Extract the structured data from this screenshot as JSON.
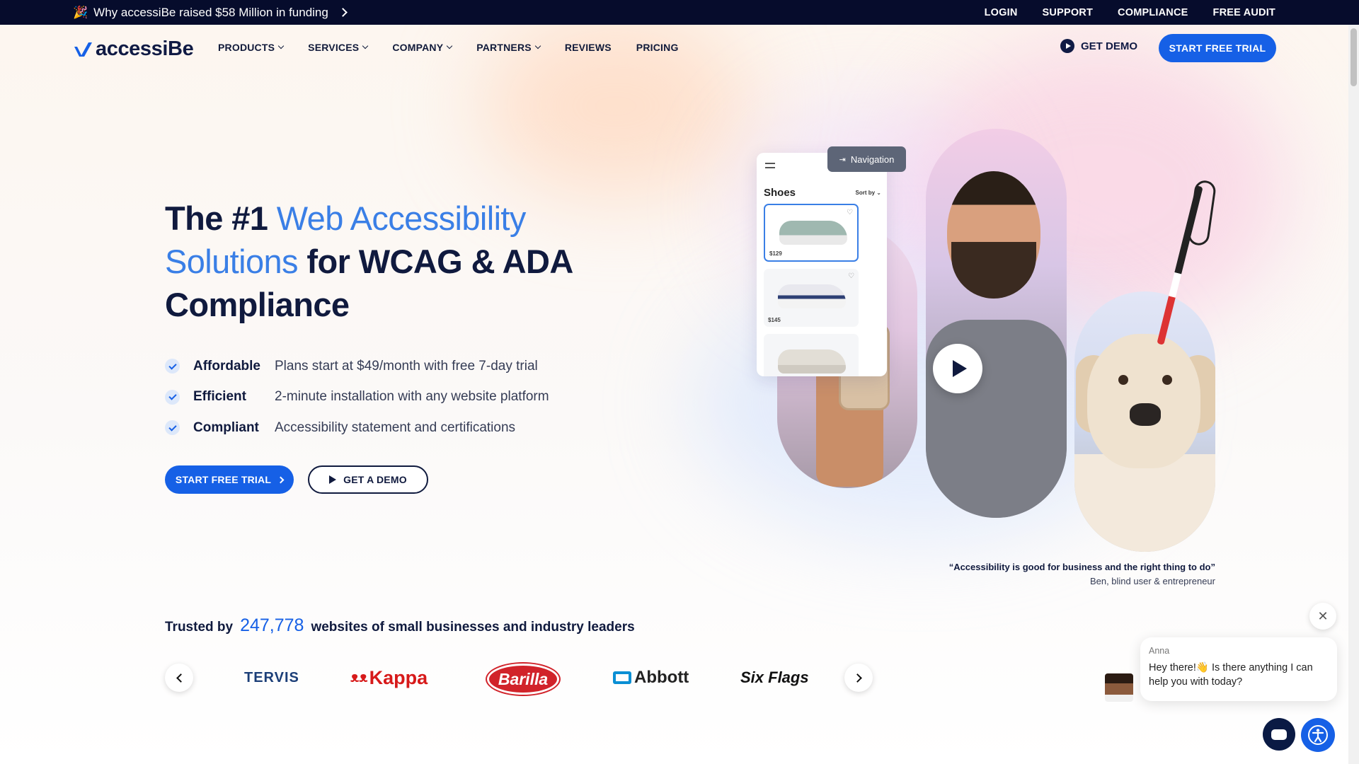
{
  "announcement": {
    "emoji": "🎉",
    "text": "Why accessiBe raised $58 Million in funding"
  },
  "top_links": [
    "LOGIN",
    "SUPPORT",
    "COMPLIANCE",
    "FREE AUDIT"
  ],
  "logo": {
    "text": "accessiBe",
    "color": "#1660e6"
  },
  "nav": {
    "items": [
      {
        "label": "PRODUCTS",
        "dropdown": true
      },
      {
        "label": "SERVICES",
        "dropdown": true
      },
      {
        "label": "COMPANY",
        "dropdown": true
      },
      {
        "label": "PARTNERS",
        "dropdown": true
      },
      {
        "label": "REVIEWS",
        "dropdown": false
      },
      {
        "label": "PRICING",
        "dropdown": false
      }
    ],
    "get_demo": "GET DEMO",
    "start_trial": "START FREE TRIAL"
  },
  "hero": {
    "title_part1": "The #1 ",
    "title_highlight": "Web Accessibility Solutions",
    "title_part2": " for WCAG & ADA Compliance",
    "features": [
      {
        "name": "Affordable",
        "desc": "Plans start at $49/month with free 7-day trial"
      },
      {
        "name": "Efficient",
        "desc": "2-minute installation with any website platform"
      },
      {
        "name": "Compliant",
        "desc": "Accessibility statement and certifications"
      }
    ],
    "cta_primary": "START FREE TRIAL",
    "cta_secondary": "GET A DEMO"
  },
  "media": {
    "shop_title": "Shoes",
    "sort_label": "Sort by",
    "prices": [
      "$129",
      "$145"
    ],
    "nav_tooltip": "Navigation",
    "quote": "“Accessibility is good for business and the right thing to do”",
    "quote_author": "Ben, blind user & entrepreneur"
  },
  "trusted": {
    "prefix": "Trusted by",
    "count": "247,778",
    "suffix": "websites of small businesses and industry leaders",
    "brands": [
      "TERVIS",
      "Kappa",
      "Barilla",
      "Abbott",
      "Six Flags"
    ]
  },
  "chat": {
    "agent_name": "Anna",
    "message": "Hey there!👋 Is there anything I can help you with today?"
  },
  "colors": {
    "brand_blue": "#1660e6",
    "navy": "#101a3e",
    "topbar": "#060c2c"
  }
}
